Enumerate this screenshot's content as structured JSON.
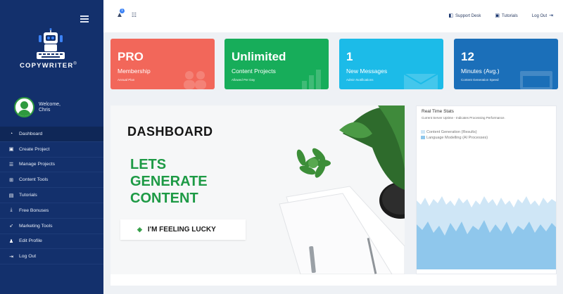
{
  "brand": {
    "name": "COPYWRITER",
    "mark": "®"
  },
  "user": {
    "welcome": "Welcome,",
    "name": "Chris"
  },
  "menu": [
    {
      "icon": "speedometer-icon",
      "label": "Dashboard"
    },
    {
      "icon": "edit-icon",
      "label": "Create Project"
    },
    {
      "icon": "list-icon",
      "label": "Manage Projects"
    },
    {
      "icon": "grid-icon",
      "label": "Content Tools"
    },
    {
      "icon": "video-icon",
      "label": "Tutorials"
    },
    {
      "icon": "download-icon",
      "label": "Free Bonuses"
    },
    {
      "icon": "rocket-icon",
      "label": "Marketing Tools"
    },
    {
      "icon": "user-icon",
      "label": "Edit Profile"
    },
    {
      "icon": "logout-icon",
      "label": "Log Out"
    }
  ],
  "topbar": {
    "notification_count": "1",
    "support": "Support Desk",
    "tutorials": "Tutorials",
    "logout": "Log Out"
  },
  "cards": [
    {
      "big": "PRO",
      "label": "Membership",
      "sub": "Annual Plan",
      "color": "#f2675a"
    },
    {
      "big": "Unlimited",
      "label": "Content Projects",
      "sub": "Allowed Per Day",
      "color": "#17ad5a"
    },
    {
      "big": "1",
      "label": "New Messages",
      "sub": "Admin Notifications",
      "color": "#1cbbe8"
    },
    {
      "big": "12",
      "label": "Minutes (Avg.)",
      "sub": "Content Generation Speed",
      "color": "#1b6fb9"
    }
  ],
  "banner": {
    "title": "DASHBOARD",
    "line1": "LETS",
    "line2": "GENERATE",
    "line3": "CONTENT",
    "button": "I'M FEELING LUCKY"
  },
  "stats": {
    "title": "Real Time Stats",
    "desc": "Current Server Uptime - Indicates Processing Performance.",
    "legend": [
      {
        "label": "Content Generation (Results)",
        "color": "#cfe6f6"
      },
      {
        "label": "Language Modelling (AI Processes)",
        "color": "#8fc7ec"
      }
    ]
  }
}
